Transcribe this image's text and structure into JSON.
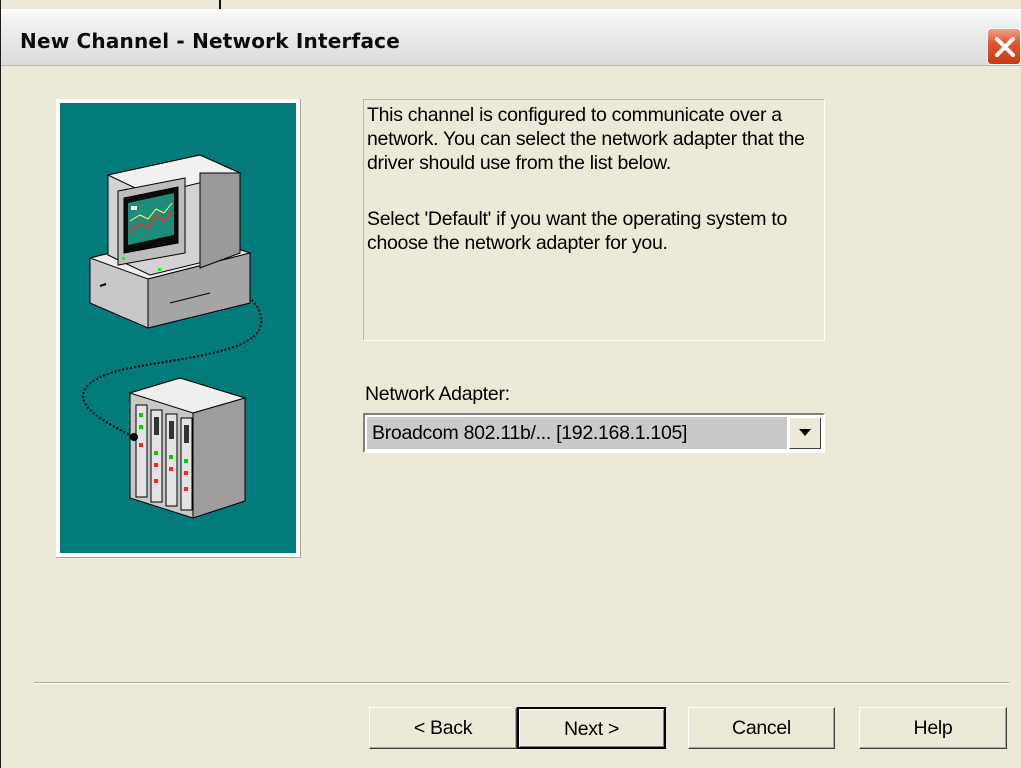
{
  "window": {
    "title": "New Channel - Network Interface"
  },
  "info": {
    "paragraph1": "This channel is configured to communicate over a network.  You can select the network adapter that the driver should use from the list below.",
    "paragraph2": "Select 'Default' if you want the operating system to choose the network adapter for you."
  },
  "network_adapter": {
    "label": "Network Adapter:",
    "selected": "Broadcom 802.11b/... [192.168.1.105]"
  },
  "buttons": {
    "back": "< Back",
    "next": "Next >",
    "cancel": "Cancel",
    "help": "Help"
  },
  "icons": {
    "close": "close-icon",
    "dropdown": "chevron-down-icon",
    "illustration": "computer-network-device-illustration"
  },
  "colors": {
    "dialog_bg": "#ece9d8",
    "illustration_bg": "#037b7b",
    "close_button": "#e1552f"
  }
}
